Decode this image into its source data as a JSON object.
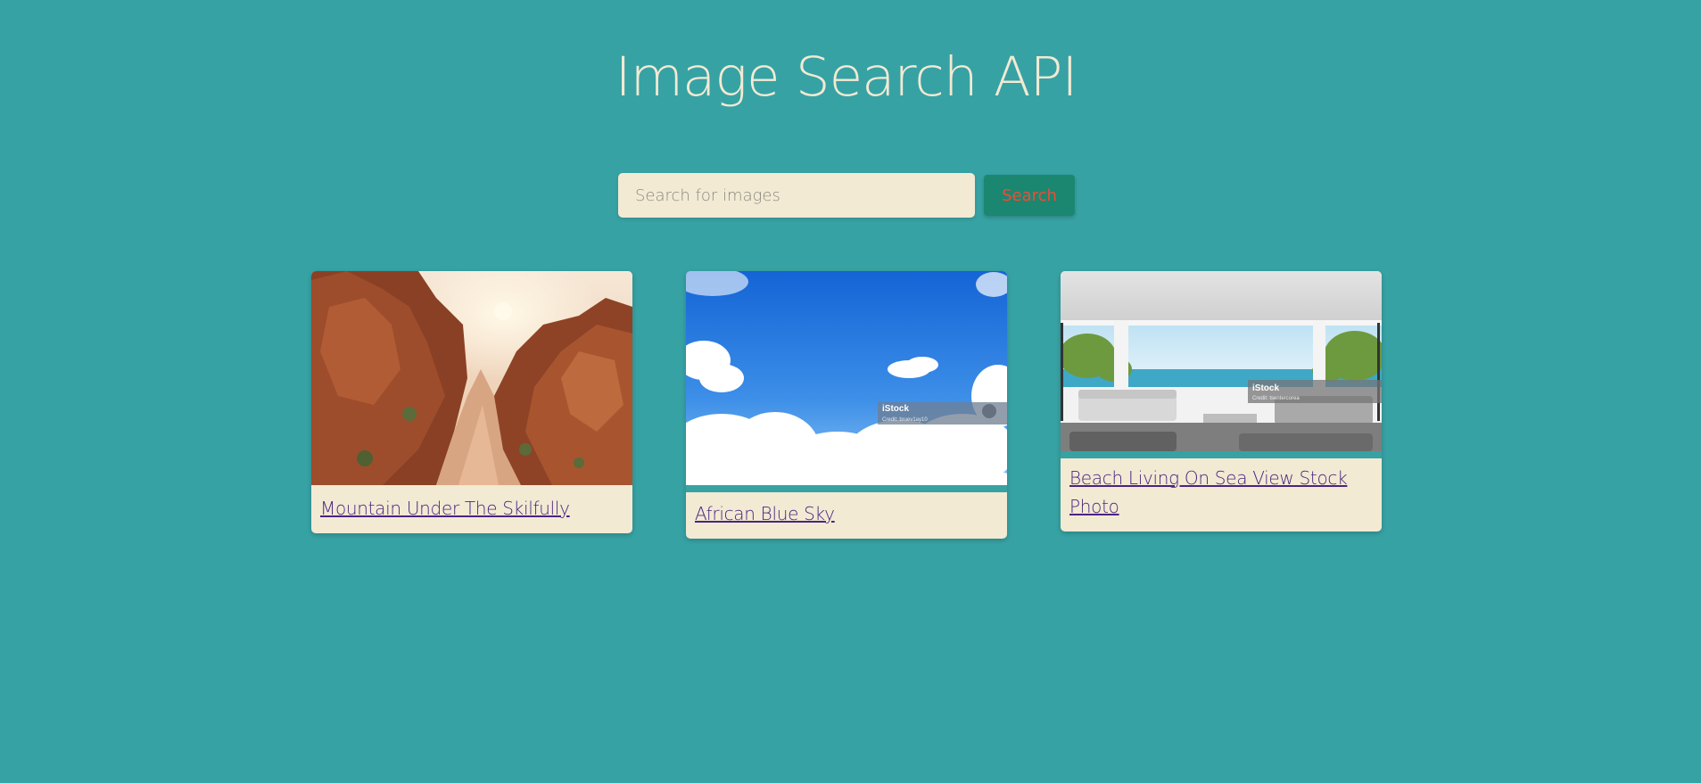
{
  "header": {
    "title": "Image Search API"
  },
  "search": {
    "placeholder": "Search for images",
    "value": "",
    "button_label": "Search"
  },
  "results": [
    {
      "title": "Mountain Under The Skilfully",
      "image": "red-rock-canyon-photo"
    },
    {
      "title": "African Blue Sky",
      "image": "blue-sky-clouds-photo",
      "watermark": "iStock",
      "credit": "Credit: bruev1ay10"
    },
    {
      "title": "Beach Living On Sea View Stock Photo",
      "image": "beach-living-room-photo",
      "watermark": "iStock",
      "credit": "Credit: tsentercorea"
    }
  ],
  "colors": {
    "background": "#37a2a4",
    "title": "#f2ead3",
    "card": "#f2ead3",
    "button_bg": "#1b8770",
    "button_text": "#f34a36",
    "link": "#4a2480"
  }
}
